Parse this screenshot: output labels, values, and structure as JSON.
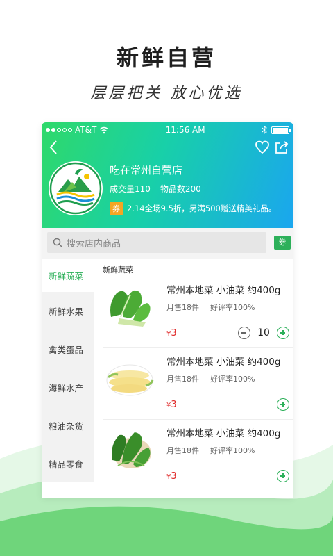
{
  "promo": {
    "title": "新鲜自营",
    "subtitle": "层层把关  放心优选"
  },
  "status_bar": {
    "carrier": "AT&T",
    "time": "11:56 AM"
  },
  "store": {
    "name": "吃在常州自营店",
    "deals_label": "成交量110",
    "items_label": "物品数200",
    "coupon_tag": "券",
    "promo_text": "2.14全场9.5折，另满500赠送精美礼品。"
  },
  "search": {
    "placeholder": "搜索店内商品",
    "coupon_label": "券"
  },
  "sidebar": {
    "items": [
      {
        "label": "新鲜蔬菜",
        "active": true
      },
      {
        "label": "新鲜水果"
      },
      {
        "label": "禽类蛋品"
      },
      {
        "label": "海鲜水产"
      },
      {
        "label": "粮油杂货"
      },
      {
        "label": "精品零食"
      }
    ]
  },
  "section_title": "新鲜蔬菜",
  "products": [
    {
      "name": "常州本地菜 小油菜 约400g",
      "sales": "月售18件",
      "rating": "好评率100%",
      "currency": "¥",
      "price": "3",
      "qty": "10",
      "image": "bok-choy"
    },
    {
      "name": "常州本地菜 小油菜 约400g",
      "sales": "月售18件",
      "rating": "好评率100%",
      "currency": "¥",
      "price": "3",
      "image": "corn"
    },
    {
      "name": "常州本地菜 小油菜 约400g",
      "sales": "月售18件",
      "rating": "好评率100%",
      "currency": "¥",
      "price": "3",
      "image": "spinach"
    }
  ],
  "colors": {
    "accent": "#2db05a",
    "price": "#e02b2b",
    "header_start": "#2fd96a",
    "header_end": "#1aa6ef"
  }
}
